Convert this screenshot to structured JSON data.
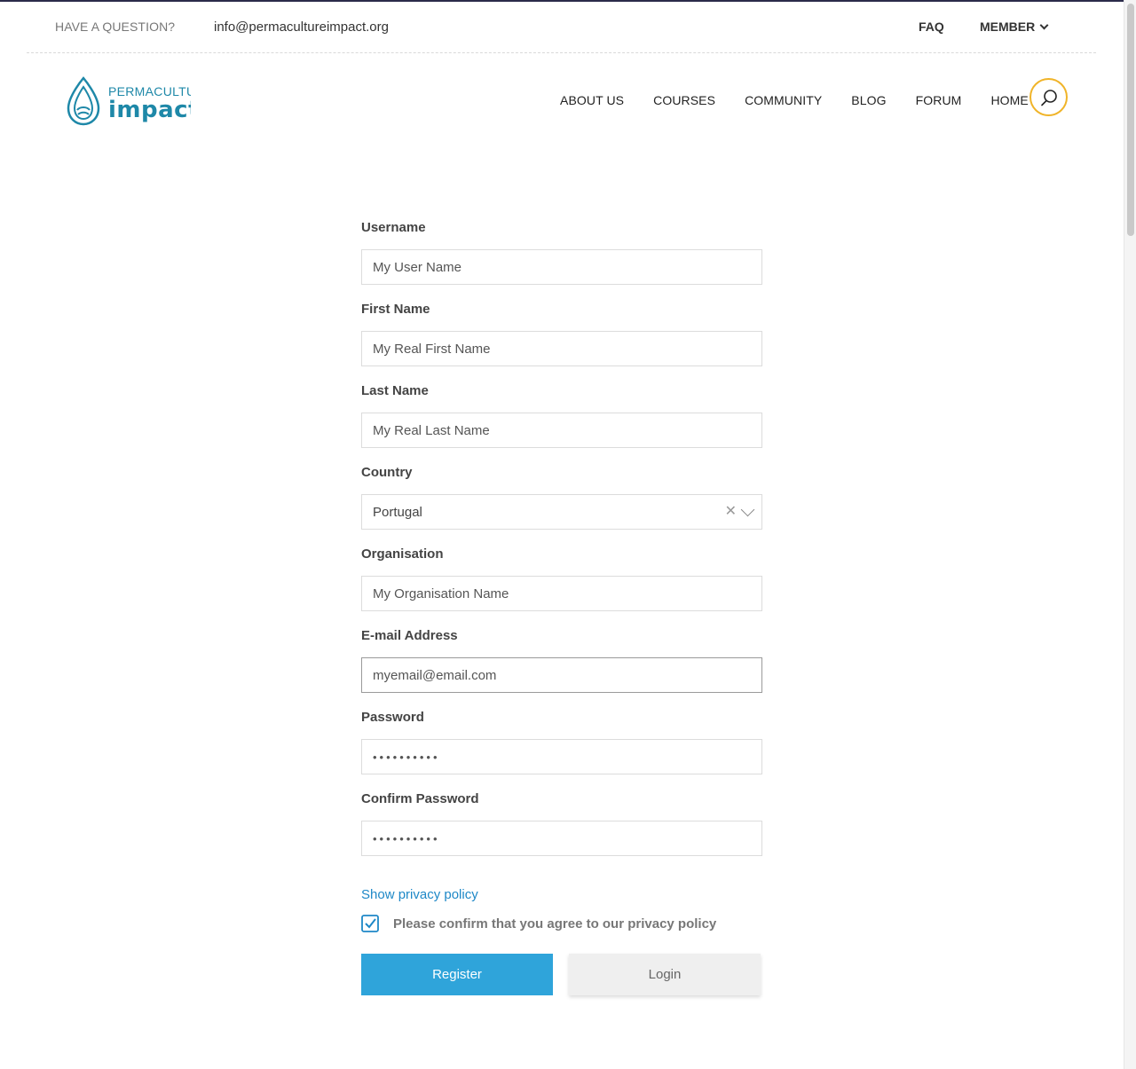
{
  "topbar": {
    "question": "HAVE A QUESTION?",
    "email": "info@permacultureimpact.org",
    "faq": "FAQ",
    "member": "MEMBER"
  },
  "brand": {
    "line1": "PERMACULTURE",
    "line2": "impact",
    "icon": "water-drop-icon",
    "accent": "#1e88a8"
  },
  "nav": {
    "items": [
      {
        "label": "ABOUT US"
      },
      {
        "label": "COURSES"
      },
      {
        "label": "COMMUNITY"
      },
      {
        "label": "BLOG"
      },
      {
        "label": "FORUM"
      },
      {
        "label": "HOME"
      }
    ],
    "search_icon": "search-icon",
    "search_ring_color": "#f0b429"
  },
  "form": {
    "username": {
      "label": "Username",
      "placeholder": "My User Name"
    },
    "first_name": {
      "label": "First Name",
      "placeholder": "My Real First Name"
    },
    "last_name": {
      "label": "Last Name",
      "placeholder": "My Real Last Name"
    },
    "country": {
      "label": "Country",
      "value": "Portugal",
      "clear_icon": "close-icon",
      "dropdown_icon": "chevron-down-icon"
    },
    "organisation": {
      "label": "Organisation",
      "placeholder": "My Organisation Name"
    },
    "email": {
      "label": "E-mail Address",
      "placeholder": "myemail@email.com"
    },
    "password": {
      "label": "Password",
      "value": "••••••••••"
    },
    "confirm_password": {
      "label": "Confirm Password",
      "value": "••••••••••"
    },
    "privacy_link": "Show privacy policy",
    "agree_text": "Please confirm that you agree to our privacy policy",
    "agree_checked": true,
    "register_label": "Register",
    "login_label": "Login",
    "register_color": "#2fa4da"
  }
}
